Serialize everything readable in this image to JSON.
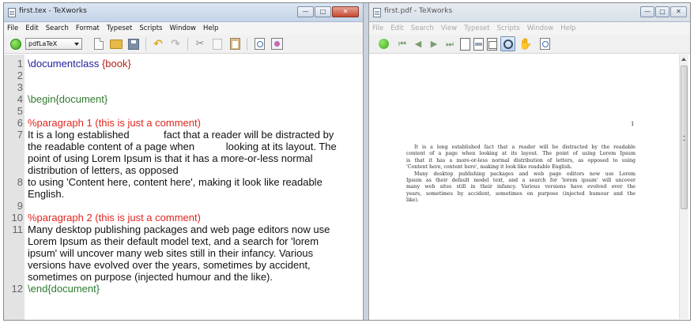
{
  "tex_window": {
    "title": "first.tex - TeXworks",
    "buttons": {
      "minimize": "—",
      "maximize": "□",
      "close": "✕"
    },
    "menu": [
      "File",
      "Edit",
      "Search",
      "Format",
      "Typeset",
      "Scripts",
      "Window",
      "Help"
    ],
    "engine": "pdfLaTeX",
    "icons": [
      "typeset-play-icon",
      "new-document-icon",
      "open-folder-icon",
      "save-icon",
      "undo-icon",
      "redo-icon",
      "cut-icon",
      "copy-icon",
      "paste-icon",
      "find-icon",
      "replace-icon"
    ]
  },
  "editor": {
    "lines": [
      {
        "num": "1",
        "parts": [
          {
            "t": "\\documentclass ",
            "c": "cmd"
          },
          {
            "t": "{book}",
            "c": "arg"
          }
        ]
      },
      {
        "num": "2",
        "parts": []
      },
      {
        "num": "3",
        "parts": []
      },
      {
        "num": "4",
        "parts": [
          {
            "t": "\\begin{document}",
            "c": "env"
          }
        ]
      },
      {
        "num": "5",
        "parts": []
      },
      {
        "num": "6",
        "parts": [
          {
            "t": "%paragraph 1 (this is just a comment)",
            "c": "comment"
          }
        ]
      },
      {
        "num": "7",
        "parts": [
          {
            "t": "It is a long established            fact that a reader will be distracted by",
            "c": "text"
          }
        ]
      },
      {
        "num": "",
        "parts": [
          {
            "t": "the readable content of a page when           looking at its layout. The",
            "c": "text"
          }
        ]
      },
      {
        "num": "",
        "parts": [
          {
            "t": "point of using Lorem Ipsum is that it has a more-or-less normal",
            "c": "text"
          }
        ]
      },
      {
        "num": "",
        "parts": [
          {
            "t": "distribution of letters, as opposed",
            "c": "text"
          }
        ]
      },
      {
        "num": "8",
        "parts": [
          {
            "t": "to using 'Content here, content here', making it look like readable",
            "c": "text"
          }
        ]
      },
      {
        "num": "",
        "parts": [
          {
            "t": "English.",
            "c": "text"
          }
        ]
      },
      {
        "num": "9",
        "parts": []
      },
      {
        "num": "10",
        "highlight": true,
        "parts": [
          {
            "t": "%paragraph 2 (this is just a comment)",
            "c": "comment"
          }
        ]
      },
      {
        "num": "11",
        "parts": [
          {
            "t": "Many desktop publishing packages and web page editors now use",
            "c": "text"
          }
        ]
      },
      {
        "num": "",
        "parts": [
          {
            "t": "Lorem Ipsum as their default model text, and a search for 'lorem",
            "c": "text"
          }
        ]
      },
      {
        "num": "",
        "parts": [
          {
            "t": "ipsum' will uncover many web sites still in their infancy. Various",
            "c": "text"
          }
        ]
      },
      {
        "num": "",
        "parts": [
          {
            "t": "versions have evolved over the years, sometimes by accident,",
            "c": "text"
          }
        ]
      },
      {
        "num": "",
        "parts": [
          {
            "t": "sometimes on purpose (injected humour and the like).",
            "c": "text"
          }
        ]
      },
      {
        "num": "12",
        "parts": [
          {
            "t": "\\end{document}",
            "c": "env"
          }
        ]
      }
    ]
  },
  "pdf_window": {
    "title": "first.pdf - TeXworks",
    "buttons": {
      "minimize": "—",
      "maximize": "□",
      "close": "✕"
    },
    "menu": [
      "File",
      "Edit",
      "Search",
      "View",
      "Typeset",
      "Scripts",
      "Window",
      "Help"
    ],
    "icons": [
      "typeset-play-icon",
      "first-page-icon",
      "previous-page-icon",
      "next-page-icon",
      "last-page-icon",
      "actual-size-icon",
      "fit-width-icon",
      "fit-window-icon",
      "magnify-icon",
      "hand-tool-icon",
      "find-icon"
    ],
    "page_number": "1",
    "paragraph_lines": [
      "It is a long established fact that a reader will be distracted by the readable",
      "content of a page when looking at its layout. The point of using Lorem Ipsum",
      "is that it has a more-or-less normal distribution of letters, as opposed to using",
      "'Content here, content here', making it look like readable English.",
      "Many desktop publishing packages and web page editors now use Lorem",
      "Ipsum as their default model text, and a search for 'lorem ipsum' will uncover",
      "many web sites still in their infancy. Various versions have evolved over the",
      "years, sometimes by accident, sometimes on purpose (injected humour and the",
      "like)."
    ]
  }
}
